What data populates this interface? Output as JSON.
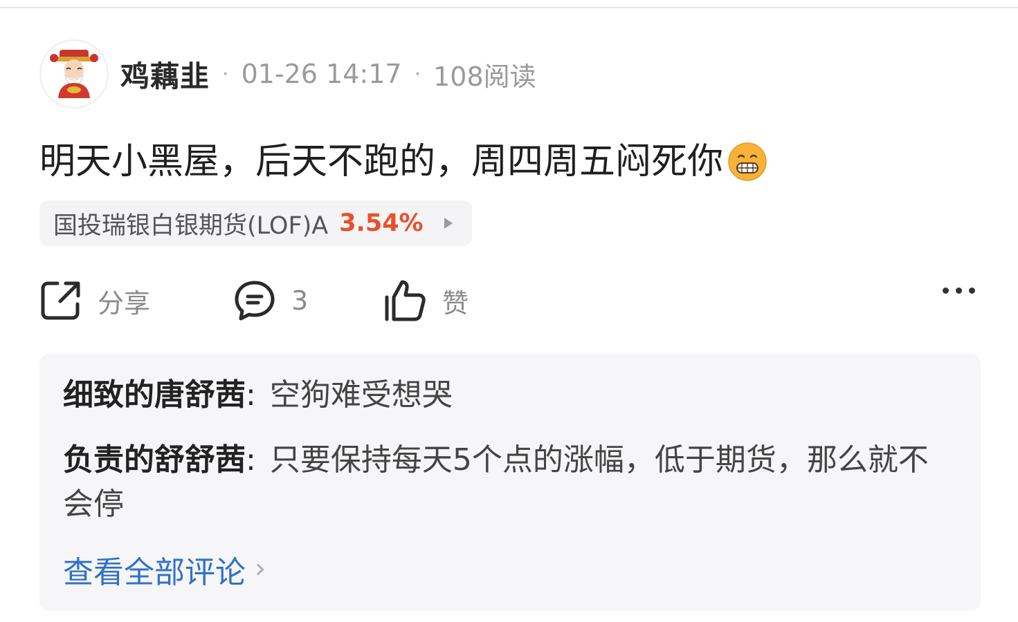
{
  "post": {
    "author": "鸡藕韭",
    "date": "01-26 14:17",
    "reads": "108阅读",
    "content": "明天小黑屋，后天不跑的，周四周五闷死你",
    "stock": {
      "name": "国投瑞银白银期货(LOF)A",
      "change": "3.54%"
    }
  },
  "actions": {
    "share": "分享",
    "comments": "3",
    "like": "赞"
  },
  "comments": [
    {
      "user": "细致的唐舒茜",
      "text": "空狗难受想哭"
    },
    {
      "user": "负责的舒舒茜",
      "text": "只要保持每天5个点的涨幅，低于期货，那么就不会停"
    }
  ],
  "view_all": "查看全部评论",
  "colors": {
    "accent_red": "#e8502a",
    "link_blue": "#2f71c8"
  },
  "icons": [
    "avatar-caishen",
    "emoji-grimace",
    "share-icon",
    "comment-icon",
    "thumbs-up-icon",
    "more-icon"
  ]
}
